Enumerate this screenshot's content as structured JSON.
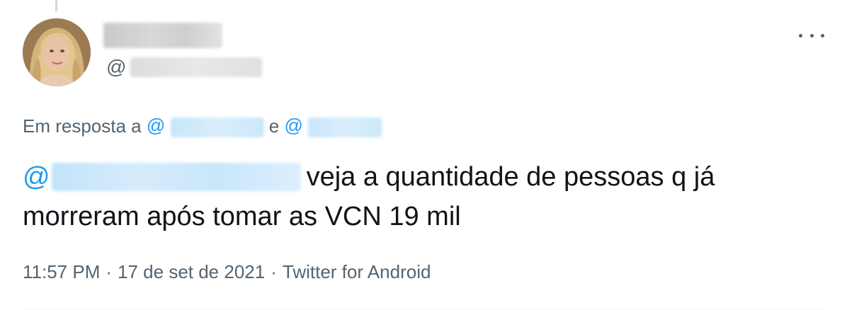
{
  "tweet": {
    "handle_prefix": "@",
    "reply": {
      "prefix": "Em resposta a",
      "mention1_prefix": "@",
      "connector": "e",
      "mention2_prefix": "@"
    },
    "text": {
      "mention_prefix": "@",
      "line1": "veja a quantidade de pessoas q já",
      "line2": "morreram após tomar as VCN 19 mil"
    },
    "meta": {
      "time": "11:57 PM",
      "date": "17 de set de 2021",
      "source": "Twitter for Android",
      "separator": "·"
    }
  },
  "colors": {
    "link": "#1d9bf0",
    "secondary_text": "#536471",
    "primary_text": "#0f1419"
  },
  "icons": {
    "more": "more-dots-icon"
  }
}
